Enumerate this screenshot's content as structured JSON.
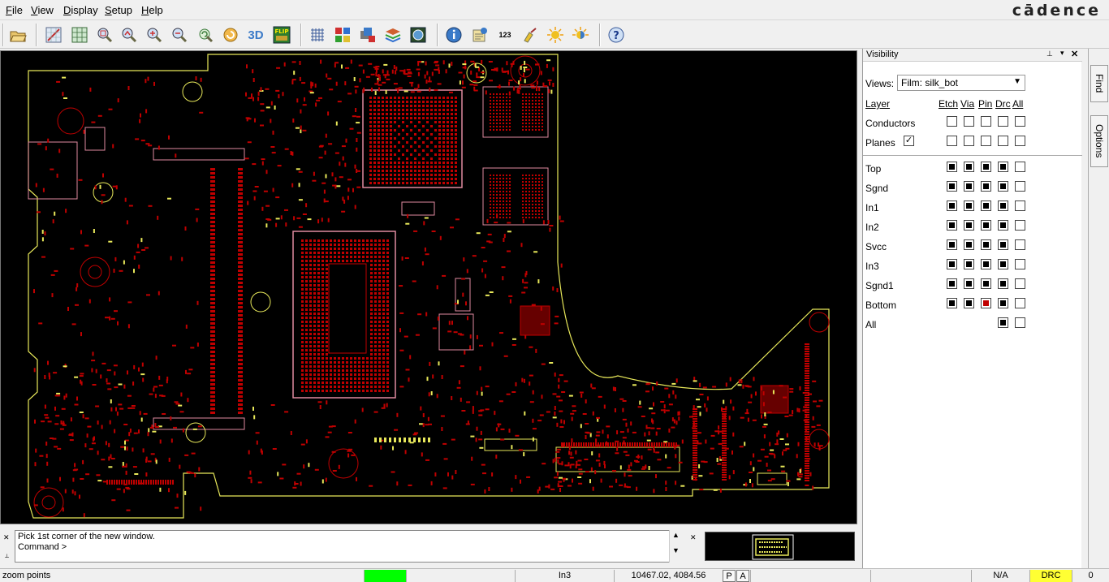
{
  "menu": {
    "file": "File",
    "view": "View",
    "display": "Display",
    "setup": "Setup",
    "help": "Help",
    "brand": "cādence"
  },
  "toolbar": {
    "icons": [
      "open-icon",
      "zoom-fit-icon",
      "zoom-grid-icon",
      "zoom-window-icon",
      "zoom-prev-icon",
      "zoom-in-icon",
      "zoom-out-icon",
      "refresh-icon",
      "redraw-icon",
      "3d-view-icon",
      "flip-icon",
      "grid-icon",
      "color-icon",
      "shadow-icon",
      "layers-icon",
      "world-view-icon",
      "info-icon",
      "measure-icon",
      "numbers-icon",
      "clean-icon",
      "sun-icon",
      "sun-half-icon",
      "help-icon"
    ],
    "label_3d": "3D",
    "label_flip": "FLIP",
    "label_123": "123"
  },
  "console": {
    "line1": "Pick 1st corner of the new window.",
    "line2": "Command >"
  },
  "visibility": {
    "title": "Visibility",
    "views_label": "Views:",
    "views_value": "Film: silk_bot",
    "layer_header": "Layer",
    "col_etch": "Etch",
    "col_via": "Via",
    "col_pin": "Pin",
    "col_drc": "Drc",
    "col_all": "All",
    "conductors": "Conductors",
    "planes": "Planes",
    "layers": [
      "Top",
      "Sgnd",
      "In1",
      "In2",
      "Svcc",
      "In3",
      "Sgnd1",
      "Bottom"
    ],
    "all_row": "All"
  },
  "side_tabs": {
    "find": "Find",
    "options": "Options"
  },
  "status": {
    "command": "zoom points",
    "layer": "In3",
    "coords": "10467.02, 4084.56",
    "p": "P",
    "a": "A",
    "na": "N/A",
    "drc": "DRC",
    "zero": "0"
  },
  "colors": {
    "status_green": "#00ff00",
    "drc_yellow": "#ffff33",
    "board_outline": "#e8e85a",
    "pad_red": "#c00000"
  }
}
